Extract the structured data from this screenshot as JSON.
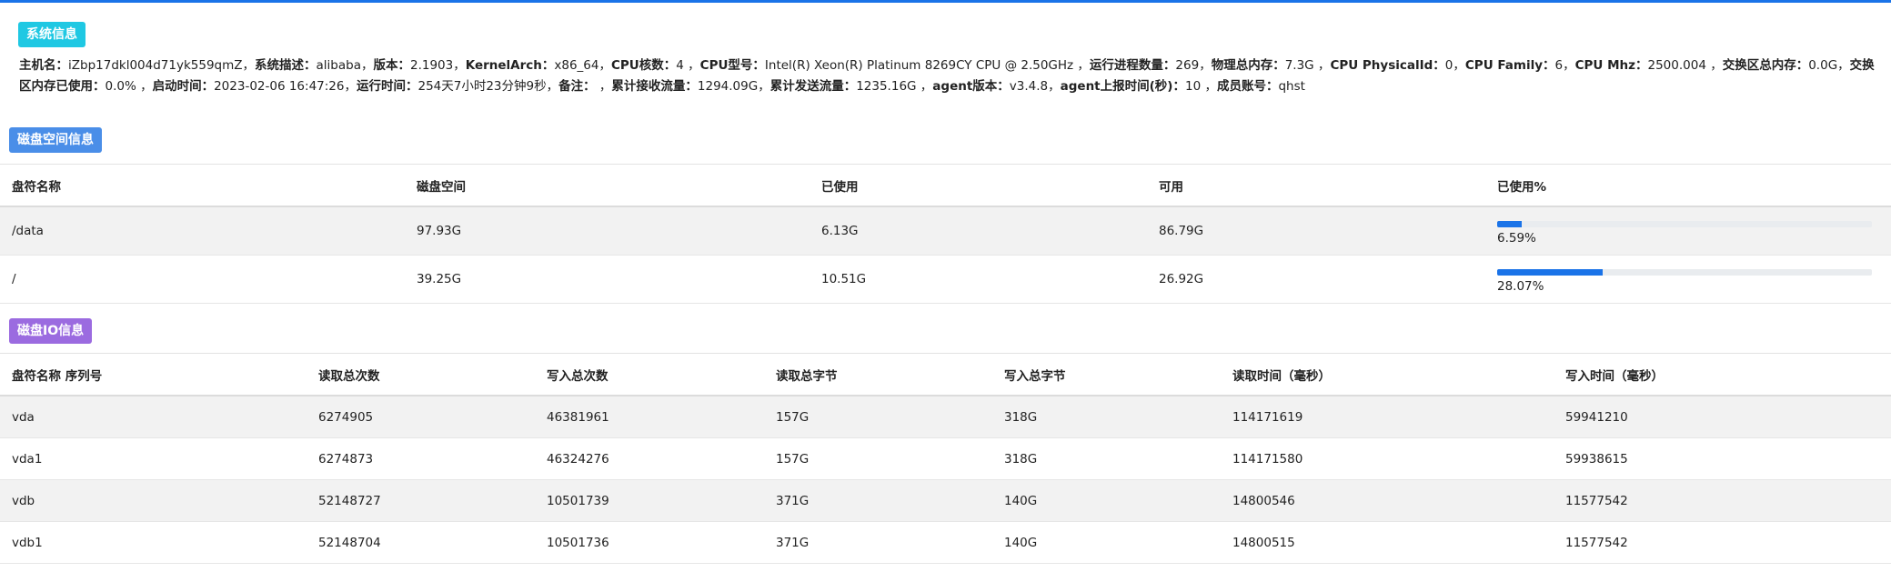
{
  "colors": {
    "accent": "#1a73e8",
    "sys_badge": "#1fc8e3",
    "disk_badge": "#4a8ee8",
    "io_badge": "#9b6be0"
  },
  "sys_section": {
    "badge": "系统信息",
    "fields": [
      {
        "label": "主机名：",
        "value": "iZbp17dkl004d71yk559qmZ，"
      },
      {
        "label": "系统描述：",
        "value": "alibaba，"
      },
      {
        "label": "版本：",
        "value": "2.1903，"
      },
      {
        "label": "KernelArch：",
        "value": "x86_64，"
      },
      {
        "label": "CPU核数：",
        "value": "4 ，"
      },
      {
        "label": "CPU型号：",
        "value": "Intel(R) Xeon(R) Platinum 8269CY CPU @ 2.50GHz ，"
      },
      {
        "label": "运行进程数量：",
        "value": "269，"
      },
      {
        "label": "物理总内存：",
        "value": "7.3G ，"
      },
      {
        "label": "CPU PhysicalId：",
        "value": "0，"
      },
      {
        "label": "CPU Family：",
        "value": "6，"
      },
      {
        "label": "CPU Mhz：",
        "value": "2500.004 ，"
      },
      {
        "label": "交换区总内存：",
        "value": "0.0G，"
      },
      {
        "label": "交换区内存已使用：",
        "value": "0.0% ，"
      },
      {
        "label": "启动时间：",
        "value": "2023-02-06 16:47:26，"
      },
      {
        "label": "运行时间：",
        "value": "254天7小时23分钟9秒，"
      },
      {
        "label": "备注：",
        "value": " ，"
      },
      {
        "label": "累计接收流量：",
        "value": "1294.09G，"
      },
      {
        "label": "累计发送流量：",
        "value": "1235.16G ，"
      },
      {
        "label": "agent版本：",
        "value": "v3.4.8，"
      },
      {
        "label": "agent上报时间(秒)：",
        "value": "10 ，"
      },
      {
        "label": "成员账号：",
        "value": "qhst"
      }
    ]
  },
  "disk_section": {
    "badge": "磁盘空间信息",
    "headers": [
      "盘符名称",
      "磁盘空间",
      "已使用",
      "可用",
      "已使用%"
    ],
    "rows": [
      {
        "name": "/data",
        "size": "97.93G",
        "used": "6.13G",
        "avail": "86.79G",
        "pct": "6.59%",
        "pct_value": 6.59
      },
      {
        "name": "/",
        "size": "39.25G",
        "used": "10.51G",
        "avail": "26.92G",
        "pct": "28.07%",
        "pct_value": 28.07
      }
    ]
  },
  "io_section": {
    "badge": "磁盘IO信息",
    "headers": [
      "盘符名称 序列号",
      "读取总次数",
      "写入总次数",
      "读取总字节",
      "写入总字节",
      "读取时间（毫秒）",
      "写入时间（毫秒）"
    ],
    "rows": [
      [
        "vda",
        "6274905",
        "46381961",
        "157G",
        "318G",
        "114171619",
        "59941210"
      ],
      [
        "vda1",
        "6274873",
        "46324276",
        "157G",
        "318G",
        "114171580",
        "59938615"
      ],
      [
        "vdb",
        "52148727",
        "10501739",
        "371G",
        "140G",
        "14800546",
        "11577542"
      ],
      [
        "vdb1",
        "52148704",
        "10501736",
        "371G",
        "140G",
        "14800515",
        "11577542"
      ]
    ]
  }
}
